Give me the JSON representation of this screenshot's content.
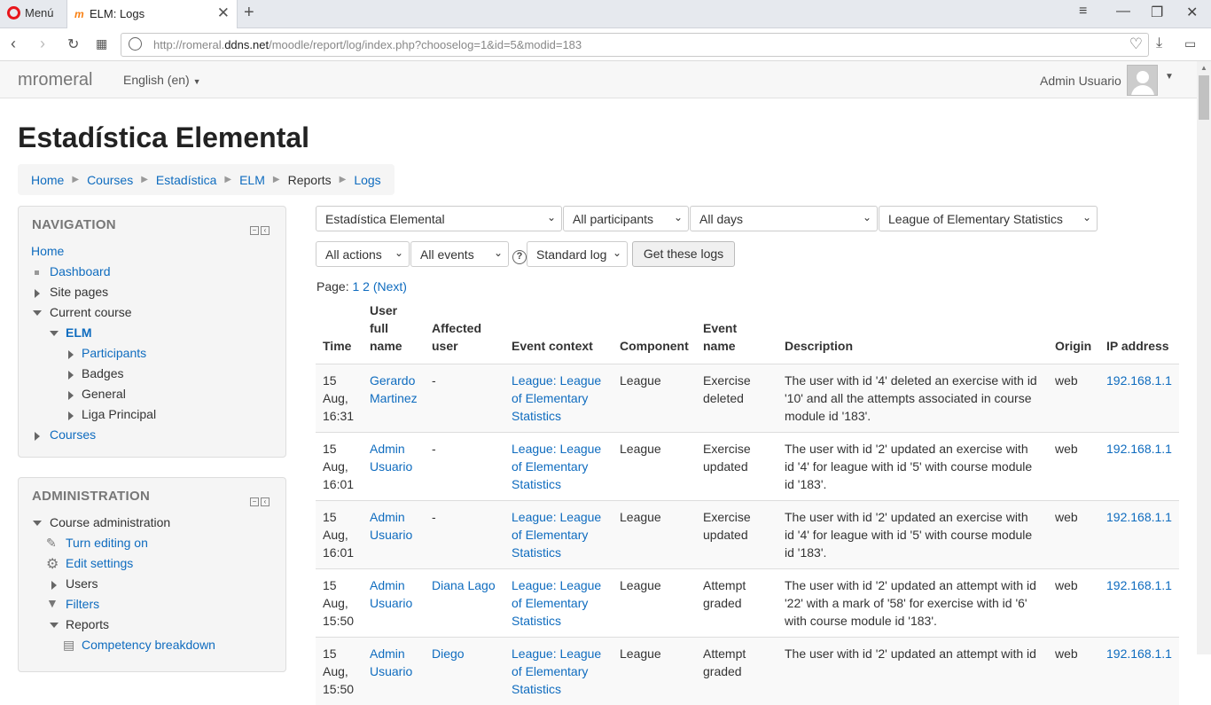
{
  "browser": {
    "menu_label": "Menú",
    "tab_title": "ELM: Logs",
    "url_prefix": "http://romeral.",
    "url_domain": "ddns.net",
    "url_path": "/moodle/report/log/index.php?chooselog=1&id=5&modid=183"
  },
  "navbar": {
    "brand": "mromeral",
    "language": "English (en)",
    "user_name": "Admin Usuario"
  },
  "page": {
    "title": "Estadística Elemental",
    "breadcrumb": [
      "Home",
      "Courses",
      "Estadística",
      "ELM",
      "Reports",
      "Logs"
    ]
  },
  "navigation": {
    "header": "Navigation",
    "home": "Home",
    "dashboard": "Dashboard",
    "site_pages": "Site pages",
    "current_course": "Current course",
    "course": "ELM",
    "participants": "Participants",
    "badges": "Badges",
    "general": "General",
    "liga": "Liga Principal",
    "courses": "Courses"
  },
  "administration": {
    "header": "Administration",
    "course_admin": "Course administration",
    "turn_editing": "Turn editing on",
    "edit_settings": "Edit settings",
    "users": "Users",
    "filters": "Filters",
    "reports": "Reports",
    "competency": "Competency breakdown"
  },
  "filters": {
    "course": "Estadística Elemental",
    "participants": "All participants",
    "days": "All days",
    "activity": "League of Elementary Statistics",
    "actions": "All actions",
    "events": "All events",
    "logtype": "Standard log",
    "submit": "Get these logs"
  },
  "pager": {
    "label": "Page:",
    "current": "1",
    "page2": "2",
    "next": "(Next)"
  },
  "table": {
    "headers": [
      "Time",
      "User full name",
      "Affected user",
      "Event context",
      "Component",
      "Event name",
      "Description",
      "Origin",
      "IP address"
    ],
    "rows": [
      {
        "time": "15 Aug, 16:31",
        "user": "Gerardo Martinez",
        "affected": "-",
        "context": "League: League of Elementary Statistics",
        "component": "League",
        "event": "Exercise deleted",
        "description": "The user with id '4' deleted an exercise with id '10' and all the attempts associated in course module id '183'.",
        "origin": "web",
        "ip": "192.168.1.1"
      },
      {
        "time": "15 Aug, 16:01",
        "user": "Admin Usuario",
        "affected": "-",
        "context": "League: League of Elementary Statistics",
        "component": "League",
        "event": "Exercise updated",
        "description": "The user with id '2' updated an exercise with id '4' for league with id '5' with course module id '183'.",
        "origin": "web",
        "ip": "192.168.1.1"
      },
      {
        "time": "15 Aug, 16:01",
        "user": "Admin Usuario",
        "affected": "-",
        "context": "League: League of Elementary Statistics",
        "component": "League",
        "event": "Exercise updated",
        "description": "The user with id '2' updated an exercise with id '4' for league with id '5' with course module id '183'.",
        "origin": "web",
        "ip": "192.168.1.1"
      },
      {
        "time": "15 Aug, 15:50",
        "user": "Admin Usuario",
        "affected": "Diana Lago",
        "context": "League: League of Elementary Statistics",
        "component": "League",
        "event": "Attempt graded",
        "description": "The user with id '2' updated an attempt with id '22' with a mark of '58' for exercise with id '6' with course module id '183'.",
        "origin": "web",
        "ip": "192.168.1.1"
      },
      {
        "time": "15 Aug, 15:50",
        "user": "Admin Usuario",
        "affected": "Diego",
        "context": "League: League of Elementary Statistics",
        "component": "League",
        "event": "Attempt graded",
        "description": "The user with id '2' updated an attempt with id",
        "origin": "web",
        "ip": "192.168.1.1"
      }
    ]
  }
}
